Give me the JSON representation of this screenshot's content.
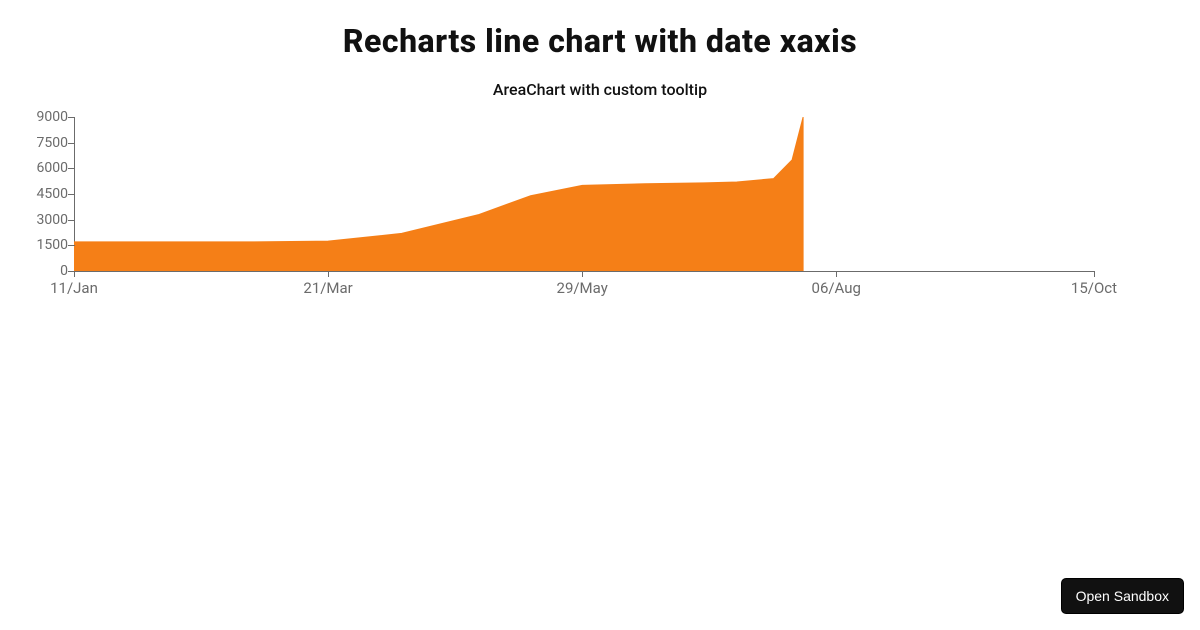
{
  "title": "Recharts line chart with date xaxis",
  "subtitle": "AreaChart with custom tooltip",
  "sandbox_button": "Open Sandbox",
  "chart_data": {
    "type": "area",
    "title": "AreaChart with custom tooltip",
    "xlabel": "",
    "ylabel": "",
    "ylim": [
      0,
      9000
    ],
    "y_ticks": [
      0,
      1500,
      3000,
      4500,
      6000,
      7500,
      9000
    ],
    "x_ticks": [
      "11/Jan",
      "21/Mar",
      "29/May",
      "06/Aug",
      "15/Oct"
    ],
    "x": [
      "11/Jan",
      "01/Feb",
      "01/Mar",
      "21/Mar",
      "10/Apr",
      "01/May",
      "15/May",
      "29/May",
      "15/Jun",
      "01/Jul",
      "10/Jul",
      "20/Jul",
      "25/Jul",
      "28/Jul"
    ],
    "values": [
      1700,
      1700,
      1700,
      1750,
      2200,
      3300,
      4400,
      5000,
      5100,
      5150,
      5200,
      5400,
      6500,
      9000
    ],
    "fill_color": "#f57f17",
    "area_opacity": 1.0
  }
}
